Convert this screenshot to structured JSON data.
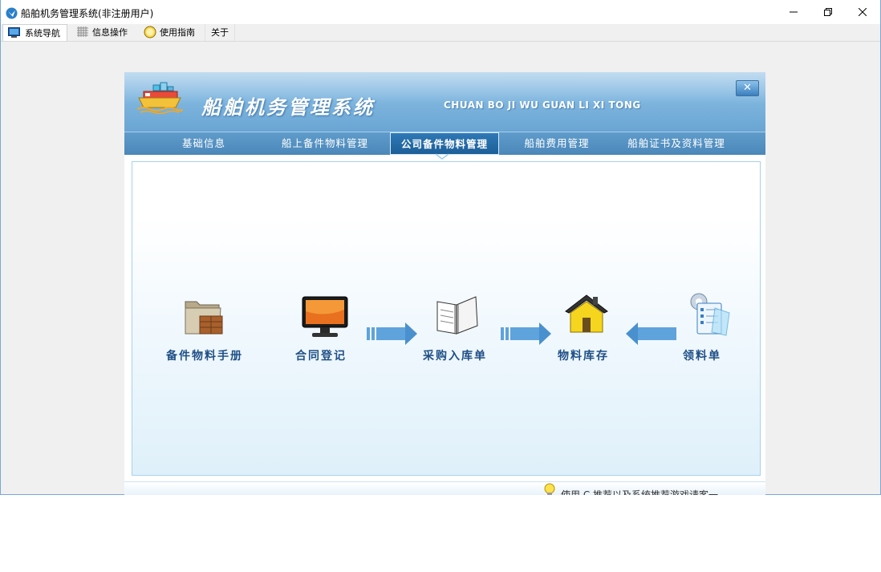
{
  "window": {
    "title": "船舶机务管理系统(非注册用户)",
    "controls": {
      "minimize": "minimize-icon",
      "maximize": "restore-icon",
      "close": "close-icon"
    }
  },
  "menubar": {
    "items": [
      {
        "label": "系统导航",
        "icon": "monitor-icon"
      },
      {
        "label": "信息操作",
        "icon": "grid-icon"
      },
      {
        "label": "使用指南",
        "icon": "help-circle-icon"
      },
      {
        "label": "关于"
      }
    ]
  },
  "panel": {
    "title": "船舶机务管理系统",
    "subtitle": "CHUAN BO JI WU GUAN LI XI TONG",
    "close_label": "✕",
    "tabs": [
      {
        "label": "基础信息",
        "active": false
      },
      {
        "label": "船上备件物料管理",
        "active": false
      },
      {
        "label": "公司备件物料管理",
        "active": true
      },
      {
        "label": "船舶费用管理",
        "active": false
      },
      {
        "label": "船舶证书及资料管理",
        "active": false
      }
    ],
    "flow": [
      {
        "label": "备件物料手册",
        "icon": "folder-box-icon"
      },
      {
        "label": "合同登记",
        "icon": "monitor-screen-icon"
      },
      {
        "label": "采购入库单",
        "icon": "open-book-icon"
      },
      {
        "label": "物料库存",
        "icon": "warehouse-house-icon"
      },
      {
        "label": "领料单",
        "icon": "checklist-gear-icon"
      }
    ],
    "status_text": "使用 C 推荐以及系统推荐游戏请客一"
  },
  "colors": {
    "header_blue": "#7fb6df",
    "nav_blue": "#4b87b9",
    "label_blue": "#1f4f86",
    "arrow_blue": "#5fa3dc"
  }
}
